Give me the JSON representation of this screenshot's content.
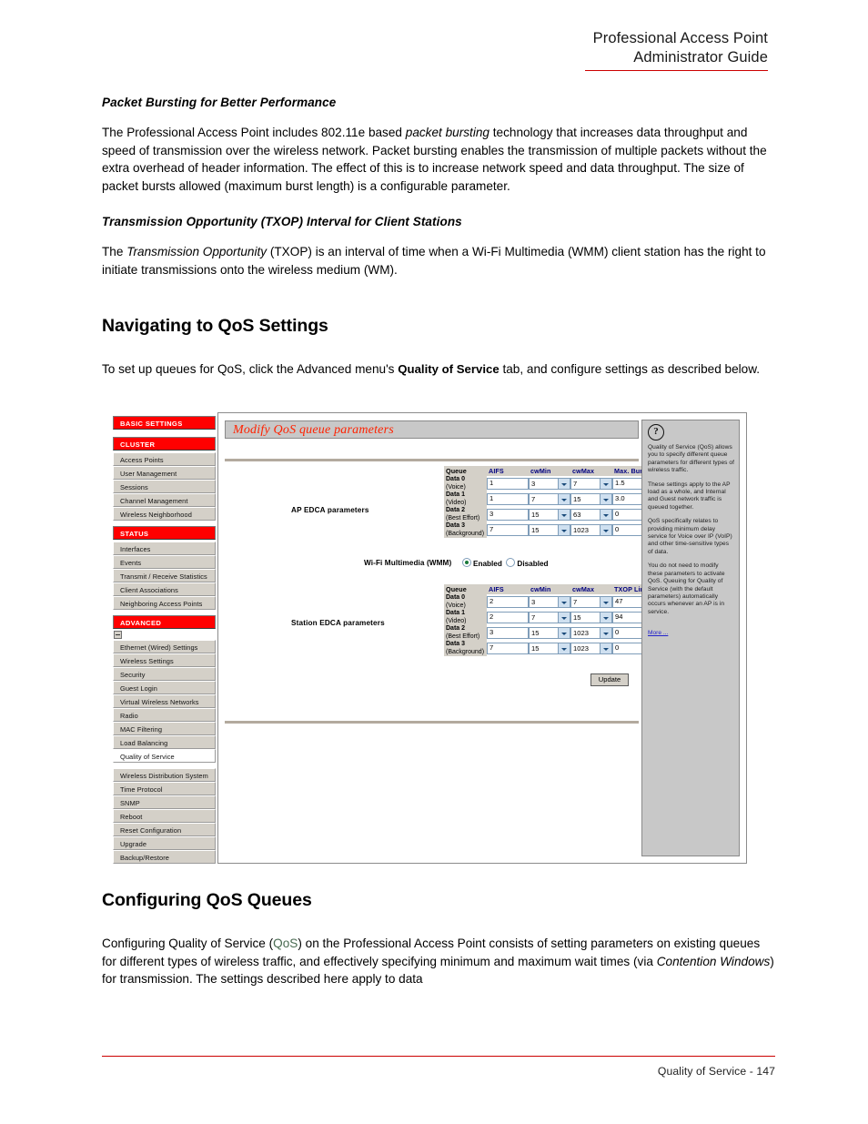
{
  "header": {
    "line1": "Professional Access Point",
    "line2": "Administrator Guide"
  },
  "body": {
    "heading_packet_bursting": "Packet Bursting for Better Performance",
    "para_packet_bursting_1": "The Professional Access Point includes 802.11e based ",
    "para_packet_bursting_em": "packet bursting",
    "para_packet_bursting_2": " technology that increases data throughput and speed of transmission over the wireless network. Packet bursting enables the transmission of multiple packets without the extra overhead of header information. The effect of this is to increase network speed and data throughput. The size of packet bursts allowed (maximum burst length) is a configurable parameter.",
    "heading_txop": "Transmission Opportunity (TXOP) Interval for Client Stations",
    "para_txop_1": "The ",
    "para_txop_em": "Transmission Opportunity",
    "para_txop_2": " (TXOP) is an interval of time when a Wi-Fi Multimedia (WMM) client station has the right to initiate transmissions onto the wireless medium (WM).",
    "heading_navigating": "Navigating to QoS Settings",
    "para_navigating_1": "To set up queues for QoS, click the Advanced menu's ",
    "para_navigating_bold": "Quality of Service",
    "para_navigating_2": " tab, and configure settings as described below.",
    "heading_configuring": "Configuring QoS Queues",
    "para_configuring_1": "Configuring Quality of Service (",
    "para_configuring_qos": "QoS",
    "para_configuring_2": ") on the Professional Access Point consists of setting parameters on existing queues for different types of wireless traffic, and effectively specifying minimum and maximum wait times (via ",
    "para_configuring_em": "Contention Windows",
    "para_configuring_3": ") for transmission. The settings described here apply to data"
  },
  "screenshot": {
    "nav": {
      "sections": [
        {
          "type": "section",
          "label": "BASIC SETTINGS"
        },
        {
          "type": "gap"
        },
        {
          "type": "section",
          "label": "CLUSTER"
        },
        {
          "type": "item",
          "label": "Access Points"
        },
        {
          "type": "item",
          "label": "User Management"
        },
        {
          "type": "item",
          "label": "Sessions"
        },
        {
          "type": "item",
          "label": "Channel Management"
        },
        {
          "type": "item",
          "label": "Wireless Neighborhood"
        },
        {
          "type": "gap"
        },
        {
          "type": "section",
          "label": "STATUS"
        },
        {
          "type": "item",
          "label": "Interfaces"
        },
        {
          "type": "item",
          "label": "Events"
        },
        {
          "type": "item",
          "label": "Transmit / Receive Statistics"
        },
        {
          "type": "item",
          "label": "Client Associations"
        },
        {
          "type": "item",
          "label": "Neighboring Access Points"
        },
        {
          "type": "gap"
        },
        {
          "type": "section",
          "label": "ADVANCED"
        },
        {
          "type": "toggle"
        },
        {
          "type": "item",
          "label": "Ethernet (Wired) Settings"
        },
        {
          "type": "item",
          "label": "Wireless Settings"
        },
        {
          "type": "item",
          "label": "Security"
        },
        {
          "type": "item",
          "label": "Guest Login"
        },
        {
          "type": "item",
          "label": "Virtual Wireless Networks"
        },
        {
          "type": "item",
          "label": "Radio"
        },
        {
          "type": "item",
          "label": "MAC Filtering"
        },
        {
          "type": "item",
          "label": "Load Balancing"
        },
        {
          "type": "item",
          "label": "Quality of Service",
          "selected": true
        },
        {
          "type": "gap"
        },
        {
          "type": "item",
          "label": "Wireless Distribution System"
        },
        {
          "type": "item",
          "label": "Time Protocol"
        },
        {
          "type": "item",
          "label": "SNMP"
        },
        {
          "type": "item",
          "label": "Reboot"
        },
        {
          "type": "item",
          "label": "Reset Configuration"
        },
        {
          "type": "item",
          "label": "Upgrade"
        },
        {
          "type": "item",
          "label": "Backup/Restore"
        }
      ]
    },
    "panel_title": "Modify QoS queue parameters",
    "ap_edca": {
      "label": "AP EDCA parameters",
      "columns": [
        "Queue",
        "AIFS",
        "cwMin",
        "cwMax",
        "Max. Burst"
      ],
      "rows": [
        {
          "queue_line1": "Data 0",
          "queue_line2": "(Voice)",
          "aifs": "1",
          "cwmin": "3",
          "cwmax": "7",
          "last": "1.5"
        },
        {
          "queue_line1": "Data 1",
          "queue_line2": "(Video)",
          "aifs": "1",
          "cwmin": "7",
          "cwmax": "15",
          "last": "3.0"
        },
        {
          "queue_line1": "Data 2",
          "queue_line2": "(Best Effort)",
          "aifs": "3",
          "cwmin": "15",
          "cwmax": "63",
          "last": "0"
        },
        {
          "queue_line1": "Data 3",
          "queue_line2": "(Background)",
          "aifs": "7",
          "cwmin": "15",
          "cwmax": "1023",
          "last": "0"
        }
      ]
    },
    "wmm": {
      "label": "Wi-Fi Multimedia (WMM)",
      "enabled_label": "Enabled",
      "disabled_label": "Disabled",
      "selected": "Enabled"
    },
    "station_edca": {
      "label": "Station EDCA parameters",
      "columns": [
        "Queue",
        "AIFS",
        "cwMin",
        "cwMax",
        "TXOP Limit"
      ],
      "rows": [
        {
          "queue_line1": "Data 0",
          "queue_line2": "(Voice)",
          "aifs": "2",
          "cwmin": "3",
          "cwmax": "7",
          "last": "47"
        },
        {
          "queue_line1": "Data 1",
          "queue_line2": "(Video)",
          "aifs": "2",
          "cwmin": "7",
          "cwmax": "15",
          "last": "94"
        },
        {
          "queue_line1": "Data 2",
          "queue_line2": "(Best Effort)",
          "aifs": "3",
          "cwmin": "15",
          "cwmax": "1023",
          "last": "0"
        },
        {
          "queue_line1": "Data 3",
          "queue_line2": "(Background)",
          "aifs": "7",
          "cwmin": "15",
          "cwmax": "1023",
          "last": "0"
        }
      ]
    },
    "update_label": "Update",
    "help": {
      "icon": "question-mark-icon",
      "p1": "Quality of Service (QoS) allows you to specify different queue parameters for different types of wireless traffic.",
      "p2": "These settings apply to the AP load as a whole, and Internal and Guest network traffic is queued together.",
      "p3": "QoS specifically relates to providing minimum delay service for Voice over IP (VoIP) and other time-sensitive types of data.",
      "p4": "You do not need to modify these parameters to activate QoS. Queuing for Quality of Service (with the default parameters) automatically occurs whenever an AP is in service.",
      "more_link": "More ..."
    }
  },
  "footer": {
    "text": "Quality of Service - 147"
  },
  "colors": {
    "accent_red": "#cc0000",
    "nav_section_red": "#ff0000",
    "title_red": "#ff2200",
    "link_blue": "#2222cc",
    "header_blue": "#000080"
  }
}
